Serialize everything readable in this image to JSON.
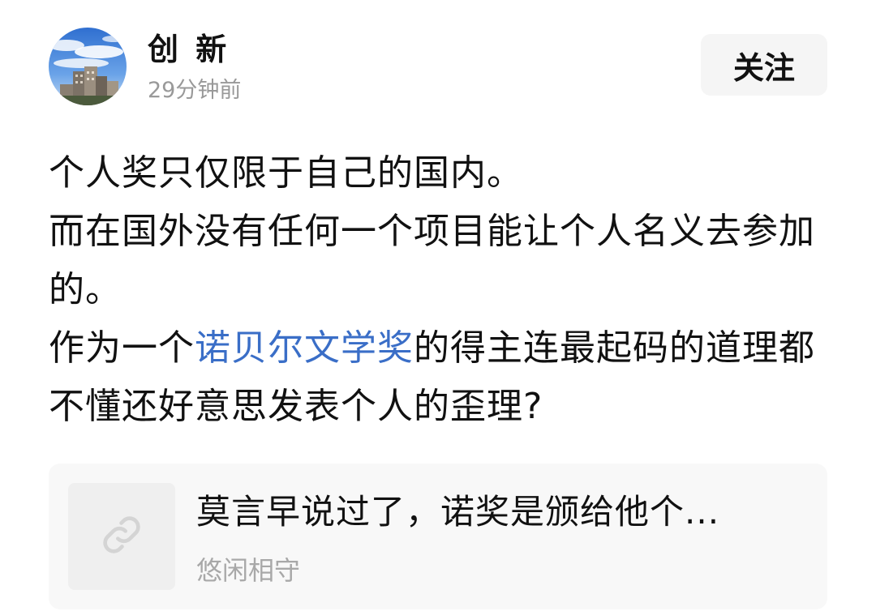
{
  "author": {
    "name": "创 新",
    "time": "29分钟前",
    "avatar_icon": "avatar-building-sky"
  },
  "follow": {
    "label": "关注"
  },
  "content": {
    "line1": "个人奖只仅限于自己的国内。",
    "line2": "而在国外没有任何一个项目能让个人名义去参加的。",
    "line3_before": "作为一个",
    "topic": "诺贝尔文学奖",
    "line3_after": "的得主连最起码的道理都不懂还好意思发表个人的歪理?",
    "link_color": "#3a6ec7"
  },
  "link_card": {
    "icon": "link-icon",
    "title": "莫言早说过了，诺奖是颁给他个...",
    "author": "悠闲相守"
  }
}
